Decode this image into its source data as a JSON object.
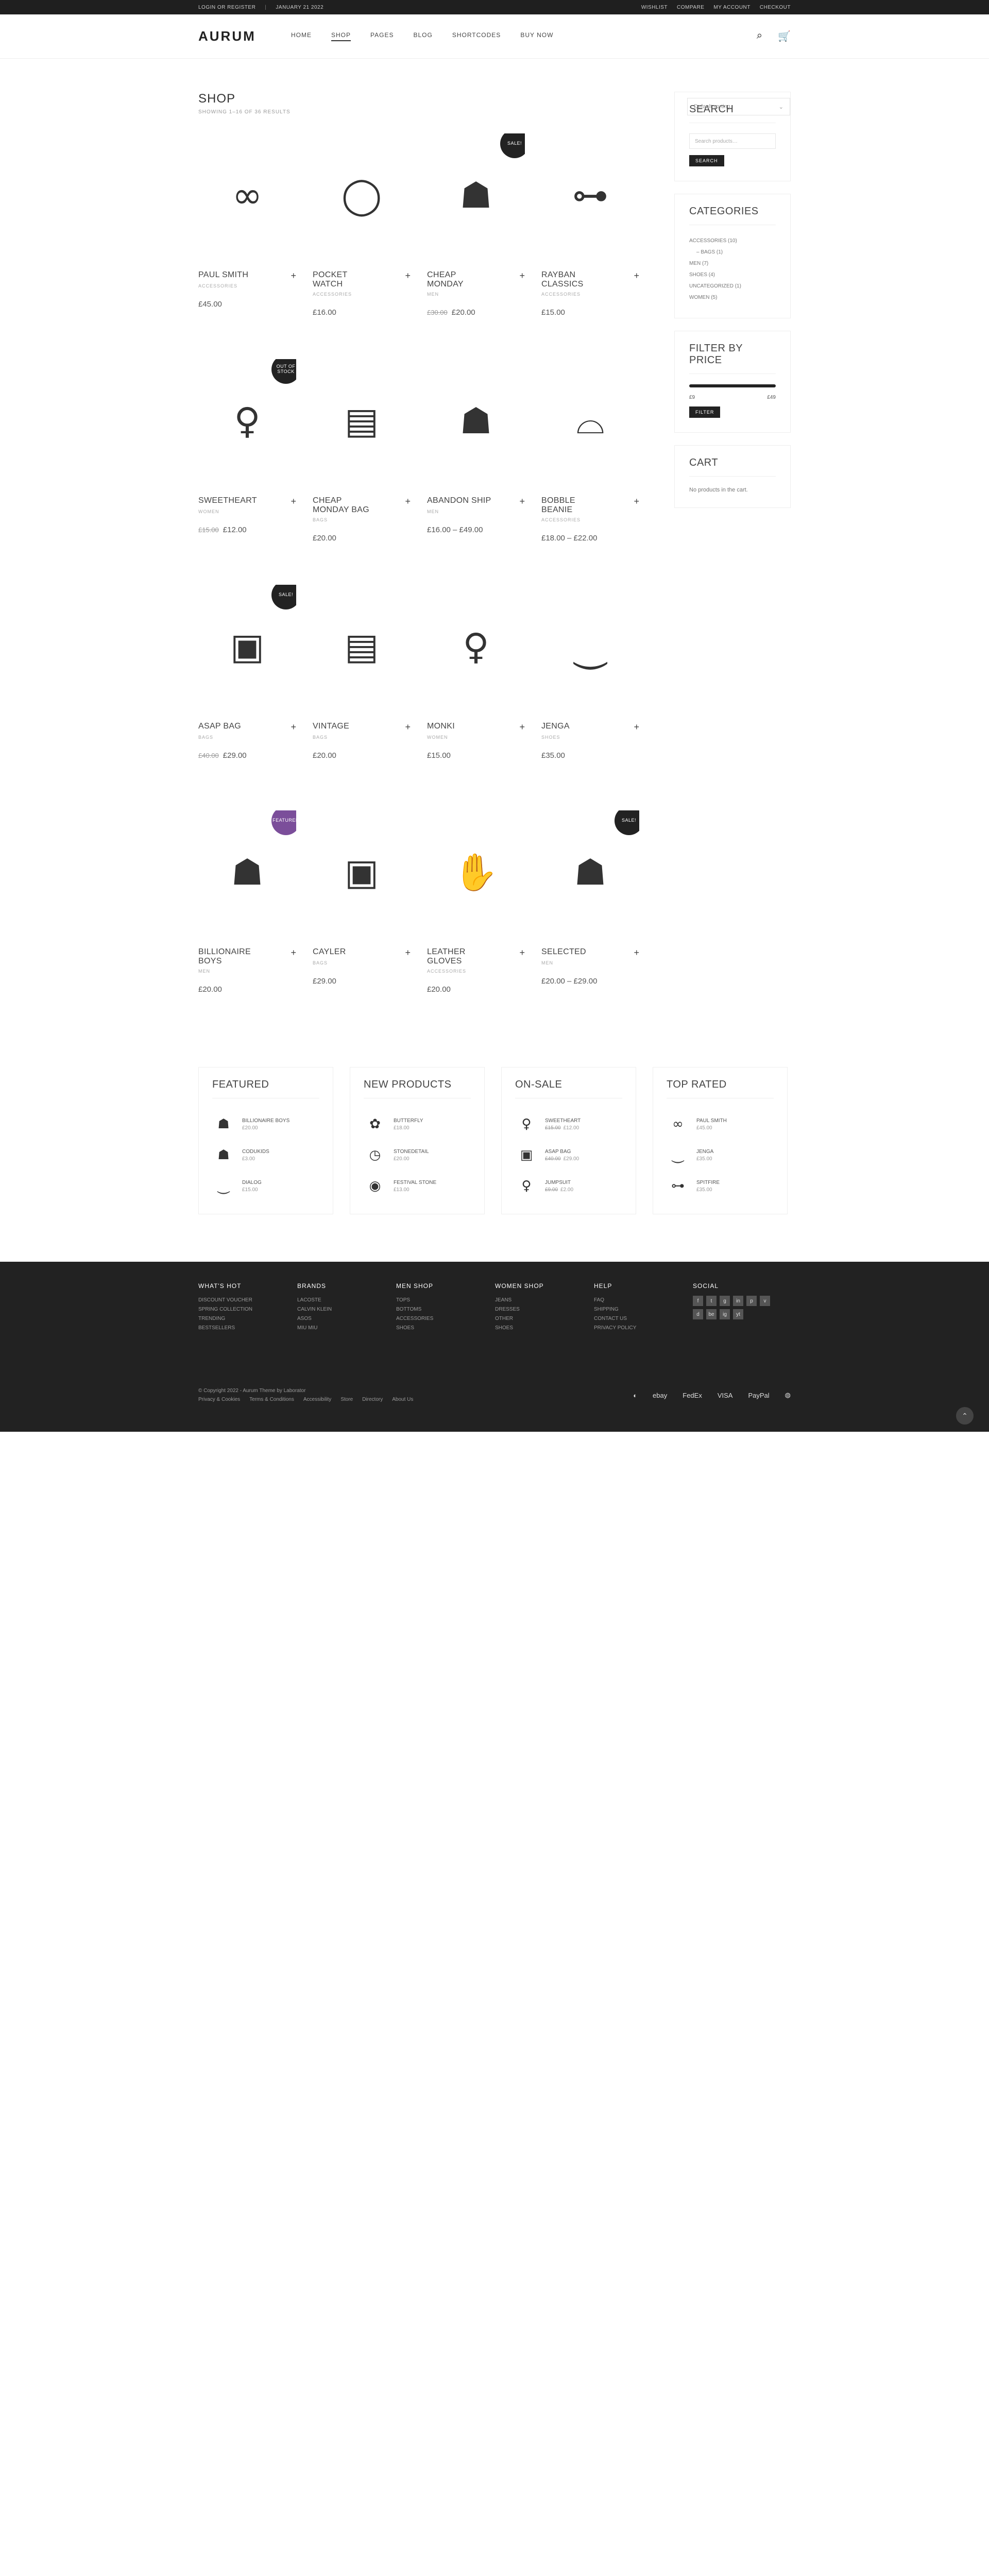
{
  "topbar": {
    "login": "LOGIN or REGISTER",
    "date": "January 21 2022",
    "links": [
      "WISHLIST",
      "COMPARE",
      "MY ACCOUNT",
      "CHECKOUT"
    ]
  },
  "header": {
    "logo": "AURUM",
    "nav": [
      "HOME",
      "SHOP",
      "PAGES",
      "BLOG",
      "SHORTCODES",
      "BUY NOW"
    ],
    "active": "SHOP"
  },
  "shop": {
    "title": "SHOP",
    "result": "SHOWING 1–16 OF 36 RESULTS",
    "sort": "Default sorting"
  },
  "products": [
    {
      "name": "PAUL SMITH",
      "cat": "ACCESSORIES",
      "price": "£45.00",
      "old": "",
      "badge": "",
      "icon": "∞"
    },
    {
      "name": "POCKET WATCH",
      "cat": "ACCESSORIES",
      "price": "£16.00",
      "old": "",
      "badge": "",
      "icon": "◯"
    },
    {
      "name": "CHEAP MONDAY",
      "cat": "MEN",
      "price": "£20.00",
      "old": "£30.00",
      "badge": "SALE!",
      "icon": "☗"
    },
    {
      "name": "RAYBAN CLASSICS",
      "cat": "ACCESSORIES",
      "price": "£15.00",
      "old": "",
      "badge": "",
      "icon": "⊶"
    },
    {
      "name": "SWEETHEART",
      "cat": "WOMEN",
      "price": "£12.00",
      "old": "£15.00",
      "badge": "OUT OF STOCK",
      "icon": "♀"
    },
    {
      "name": "CHEAP MONDAY BAG",
      "cat": "BAGS",
      "price": "£20.00",
      "old": "",
      "badge": "",
      "icon": "▤"
    },
    {
      "name": "ABANDON SHIP",
      "cat": "MEN",
      "price": "£16.00 – £49.00",
      "old": "",
      "badge": "",
      "icon": "☗"
    },
    {
      "name": "BOBBLE BEANIE",
      "cat": "ACCESSORIES",
      "price": "£18.00 – £22.00",
      "old": "",
      "badge": "",
      "icon": "⌓"
    },
    {
      "name": "ASAP BAG",
      "cat": "BAGS",
      "price": "£29.00",
      "old": "£40.00",
      "badge": "SALE!",
      "icon": "▣"
    },
    {
      "name": "VINTAGE",
      "cat": "BAGS",
      "price": "£20.00",
      "old": "",
      "badge": "",
      "icon": "▤"
    },
    {
      "name": "MONKI",
      "cat": "WOMEN",
      "price": "£15.00",
      "old": "",
      "badge": "",
      "icon": "♀"
    },
    {
      "name": "JENGA",
      "cat": "SHOES",
      "price": "£35.00",
      "old": "",
      "badge": "",
      "icon": "⏝"
    },
    {
      "name": "BILLIONAIRE BOYS",
      "cat": "MEN",
      "price": "£20.00",
      "old": "",
      "badge": "FEATURED",
      "icon": "☗"
    },
    {
      "name": "CAYLER",
      "cat": "BAGS",
      "price": "£29.00",
      "old": "",
      "badge": "",
      "icon": "▣"
    },
    {
      "name": "LEATHER GLOVES",
      "cat": "ACCESSORIES",
      "price": "£20.00",
      "old": "",
      "badge": "",
      "icon": "✋"
    },
    {
      "name": "SELECTED",
      "cat": "MEN",
      "price": "£20.00 – £29.00",
      "old": "",
      "badge": "SALE!",
      "icon": "☗"
    }
  ],
  "search": {
    "title": "SEARCH",
    "placeholder": "Search products…",
    "button": "SEARCH"
  },
  "categories": {
    "title": "CATEGORIES",
    "items": [
      {
        "label": "ACCESSORIES (10)",
        "sub": false
      },
      {
        "label": "– BAGS (1)",
        "sub": true
      },
      {
        "label": "MEN (7)",
        "sub": false
      },
      {
        "label": "SHOES (4)",
        "sub": false
      },
      {
        "label": "UNCATEGORIZED (1)",
        "sub": false
      },
      {
        "label": "WOMEN (5)",
        "sub": false
      }
    ]
  },
  "filter": {
    "title": "FILTER BY PRICE",
    "min": "£9",
    "max": "£49",
    "button": "FILTER"
  },
  "cart": {
    "title": "CART",
    "empty": "No products in the cart."
  },
  "bottom": [
    {
      "title": "FEATURED",
      "items": [
        {
          "name": "BILLIONAIRE BOYS",
          "price": "£20.00",
          "old": "",
          "icon": "☗"
        },
        {
          "name": "CODUKIDS",
          "price": "£3.00",
          "old": "",
          "icon": "☗"
        },
        {
          "name": "DIALOG",
          "price": "£15.00",
          "old": "",
          "icon": "⏝"
        }
      ]
    },
    {
      "title": "NEW PRODUCTS",
      "items": [
        {
          "name": "BUTTERFLY",
          "price": "£18.00",
          "old": "",
          "icon": "✿"
        },
        {
          "name": "STONEDETAIL",
          "price": "£20.00",
          "old": "",
          "icon": "◷"
        },
        {
          "name": "FESTIVAL STONE",
          "price": "£13.00",
          "old": "",
          "icon": "◉"
        }
      ]
    },
    {
      "title": "ON-SALE",
      "items": [
        {
          "name": "SWEETHEART",
          "price": "£12.00",
          "old": "£15.00",
          "icon": "♀"
        },
        {
          "name": "ASAP BAG",
          "price": "£29.00",
          "old": "£40.00",
          "icon": "▣"
        },
        {
          "name": "JUMPSUIT",
          "price": "£2.00",
          "old": "£9.00",
          "icon": "♀"
        }
      ]
    },
    {
      "title": "TOP RATED",
      "items": [
        {
          "name": "PAUL SMITH",
          "price": "£45.00",
          "old": "",
          "icon": "∞"
        },
        {
          "name": "JENGA",
          "price": "£35.00",
          "old": "",
          "icon": "⏝"
        },
        {
          "name": "SPITFIRE",
          "price": "£35.00",
          "old": "",
          "icon": "⊶"
        }
      ]
    }
  ],
  "footer": {
    "cols": [
      {
        "h": "WHAT'S HOT",
        "l": [
          "DISCOUNT VOUCHER",
          "SPRING COLLECTION",
          "TRENDING",
          "BESTSELLERS"
        ]
      },
      {
        "h": "BRANDS",
        "l": [
          "LACOSTE",
          "CALVIN KLEIN",
          "ASOS",
          "MIU MIU"
        ]
      },
      {
        "h": "MEN SHOP",
        "l": [
          "TOPS",
          "BOTTOMS",
          "ACCESSORIES",
          "SHOES"
        ]
      },
      {
        "h": "WOMEN SHOP",
        "l": [
          "JEANS",
          "DRESSES",
          "OTHER",
          "SHOES"
        ]
      },
      {
        "h": "HELP",
        "l": [
          "FAQ",
          "SHIPPING",
          "CONTACT US",
          "PRIVACY POLICY"
        ]
      }
    ],
    "social_title": "SOCIAL",
    "social": [
      "f",
      "t",
      "g",
      "in",
      "p",
      "v",
      "d",
      "be",
      "ig",
      "yt"
    ],
    "copyright": "© Copyright 2022 - Aurum Theme by Laborator",
    "links": [
      "Privacy & Cookies",
      "Terms & Conditions",
      "Accessibility",
      "Store",
      "Directory",
      "About Us"
    ],
    "payments": [
      "◐",
      "ebay",
      "FedEx",
      "VISA",
      "PayPal",
      "◍"
    ]
  }
}
